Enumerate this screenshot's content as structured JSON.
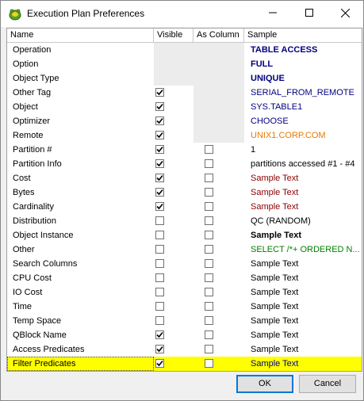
{
  "window": {
    "title": "Execution Plan Preferences"
  },
  "columns": {
    "name": "Name",
    "visible": "Visible",
    "as_column": "As Column",
    "sample": "Sample"
  },
  "rows": [
    {
      "name": "Operation",
      "visible": null,
      "as_column": null,
      "sample": "TABLE ACCESS",
      "sample_color": "#000080",
      "sample_bold": true
    },
    {
      "name": "Option",
      "visible": null,
      "as_column": null,
      "sample": "FULL",
      "sample_color": "#000080",
      "sample_bold": true
    },
    {
      "name": "Object Type",
      "visible": null,
      "as_column": null,
      "sample": "UNIQUE",
      "sample_color": "#000080",
      "sample_bold": true
    },
    {
      "name": "Other Tag",
      "visible": true,
      "as_column": null,
      "sample": "SERIAL_FROM_REMOTE",
      "sample_color": "#000080",
      "sample_bold": false
    },
    {
      "name": "Object",
      "visible": true,
      "as_column": null,
      "sample": "SYS.TABLE1",
      "sample_color": "#000080",
      "sample_bold": false
    },
    {
      "name": "Optimizer",
      "visible": true,
      "as_column": null,
      "sample": "CHOOSE",
      "sample_color": "#000080",
      "sample_bold": false
    },
    {
      "name": "Remote",
      "visible": true,
      "as_column": null,
      "sample": "UNIX1.CORP.COM",
      "sample_color": "#e87a00",
      "sample_bold": false
    },
    {
      "name": "Partition #",
      "visible": true,
      "as_column": false,
      "sample": "1",
      "sample_color": "#000000",
      "sample_bold": false
    },
    {
      "name": "Partition Info",
      "visible": true,
      "as_column": false,
      "sample": "partitions accessed #1 - #4",
      "sample_color": "#000000",
      "sample_bold": false
    },
    {
      "name": "Cost",
      "visible": true,
      "as_column": false,
      "sample": "Sample Text",
      "sample_color": "#8b0000",
      "sample_bold": false
    },
    {
      "name": "Bytes",
      "visible": true,
      "as_column": false,
      "sample": "Sample Text",
      "sample_color": "#8b0000",
      "sample_bold": false
    },
    {
      "name": "Cardinality",
      "visible": true,
      "as_column": false,
      "sample": "Sample Text",
      "sample_color": "#8b0000",
      "sample_bold": false
    },
    {
      "name": "Distribution",
      "visible": false,
      "as_column": false,
      "sample": "QC (RANDOM)",
      "sample_color": "#000000",
      "sample_bold": false
    },
    {
      "name": "Object Instance",
      "visible": false,
      "as_column": false,
      "sample": "Sample Text",
      "sample_color": "#000000",
      "sample_bold": true
    },
    {
      "name": "Other",
      "visible": false,
      "as_column": false,
      "sample": "SELECT /*+ ORDERED N...",
      "sample_color": "#008000",
      "sample_bold": false
    },
    {
      "name": "Search Columns",
      "visible": false,
      "as_column": false,
      "sample": "Sample Text",
      "sample_color": "#000000",
      "sample_bold": false
    },
    {
      "name": "CPU Cost",
      "visible": false,
      "as_column": false,
      "sample": "Sample Text",
      "sample_color": "#000000",
      "sample_bold": false
    },
    {
      "name": "IO Cost",
      "visible": false,
      "as_column": false,
      "sample": "Sample Text",
      "sample_color": "#000000",
      "sample_bold": false
    },
    {
      "name": "Time",
      "visible": false,
      "as_column": false,
      "sample": "Sample Text",
      "sample_color": "#000000",
      "sample_bold": false
    },
    {
      "name": "Temp Space",
      "visible": false,
      "as_column": false,
      "sample": "Sample Text",
      "sample_color": "#000000",
      "sample_bold": false
    },
    {
      "name": "QBlock Name",
      "visible": true,
      "as_column": false,
      "sample": "Sample Text",
      "sample_color": "#000000",
      "sample_bold": false
    },
    {
      "name": "Access Predicates",
      "visible": true,
      "as_column": false,
      "sample": "Sample Text",
      "sample_color": "#000000",
      "sample_bold": false
    },
    {
      "name": "Filter Predicates",
      "visible": true,
      "as_column": false,
      "sample": "Sample Text",
      "sample_color": "#000080",
      "sample_bold": false,
      "selected": true
    }
  ],
  "buttons": {
    "ok": "OK",
    "cancel": "Cancel"
  },
  "colors": {
    "selection": "#ffff00",
    "accent": "#0078d7"
  }
}
